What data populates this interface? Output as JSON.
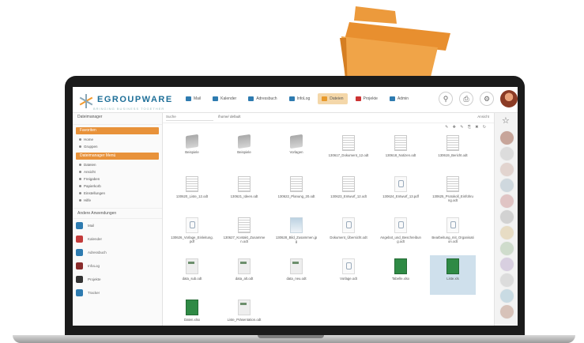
{
  "brand": {
    "name": "EGROUPWARE",
    "tagline": "BRINGING BUSINESS TOGETHER",
    "accent": "#e8923a",
    "primary": "#1e6f98"
  },
  "apps": [
    {
      "label": "Mail",
      "icon": "mail-icon"
    },
    {
      "label": "Kalender",
      "icon": "calendar-icon"
    },
    {
      "label": "Adressbuch",
      "icon": "addressbook-icon"
    },
    {
      "label": "InfoLog",
      "icon": "infolog-icon"
    },
    {
      "label": "Dateien",
      "icon": "folder-icon",
      "active": true
    },
    {
      "label": "Projekte",
      "icon": "projects-icon"
    },
    {
      "label": "Admin",
      "icon": "admin-icon"
    }
  ],
  "sidebar": {
    "header": "Dateimanager",
    "sections": [
      {
        "title": "Favoriten",
        "items": [
          "Home",
          "Gruppen"
        ]
      },
      {
        "title": "Dateimanager Menü",
        "items": [
          "Dateien",
          "Ansicht",
          "Freigaben",
          "Papierkorb",
          "Einstellungen",
          "Hilfe"
        ]
      }
    ],
    "plain": "Andere Anwendungen",
    "app_entries": [
      {
        "label": "Mail",
        "color": "#2e7bb0"
      },
      {
        "label": "Kalender",
        "color": "#c33b3b"
      },
      {
        "label": "Adressbuch",
        "color": "#2e7bb0"
      },
      {
        "label": "InfoLog",
        "color": "#8a2c2c"
      },
      {
        "label": "Projekte",
        "color": "#333333"
      },
      {
        "label": "Tracker",
        "color": "#2e7bb0"
      }
    ]
  },
  "toolbar": {
    "search_placeholder": "Suche",
    "path": "/home/ default",
    "view": "Ansicht"
  },
  "files": [
    {
      "name": "Beispiele",
      "type": "folder"
    },
    {
      "name": "Beispiele",
      "type": "folder"
    },
    {
      "name": "Vorlagen",
      "type": "folder"
    },
    {
      "name": "130617_Dokument_12.odt",
      "type": "doc"
    },
    {
      "name": "130618_Notizen.odt",
      "type": "doc"
    },
    {
      "name": "130619_Bericht.odt",
      "type": "doc"
    },
    {
      "name": "130620_Liste_12.odt",
      "type": "doc"
    },
    {
      "name": "130621_Ideen.odt",
      "type": "doc"
    },
    {
      "name": "130622_Planung_20.odt",
      "type": "doc"
    },
    {
      "name": "130623_Entwurf_12.odt",
      "type": "doc"
    },
    {
      "name": "130624_Entwurf_13.pdf",
      "type": "pdf"
    },
    {
      "name": "130625_Protokoll_Einführung.odt",
      "type": "doc"
    },
    {
      "name": "130626_Vorlage_Einleitung.pdf",
      "type": "pdf"
    },
    {
      "name": "130627_Kontakt_Zusammen.odt",
      "type": "doc"
    },
    {
      "name": "130628_Bild_Zusammen.jpg",
      "type": "img"
    },
    {
      "name": "Dokument_Übersicht.odt",
      "type": "pdf"
    },
    {
      "name": "Angebot_und_Beschreibung.odt",
      "type": "pdf"
    },
    {
      "name": "Bearbeitung_mit_Organisation.odt",
      "type": "pdf"
    },
    {
      "name": "data_sub.odt",
      "type": "odt"
    },
    {
      "name": "data_alt.odt",
      "type": "odt"
    },
    {
      "name": "data_neu.odt",
      "type": "odt"
    },
    {
      "name": "Vorlage.odt",
      "type": "pdf"
    },
    {
      "name": "Tabelle.xlsx",
      "type": "xls"
    },
    {
      "name": "Liste.xls",
      "type": "xls",
      "selected": true
    },
    {
      "name": "Daten.xlsx",
      "type": "xls"
    },
    {
      "name": "Liste_Präsentation.odt",
      "type": "odt"
    }
  ],
  "rail_count": 12
}
